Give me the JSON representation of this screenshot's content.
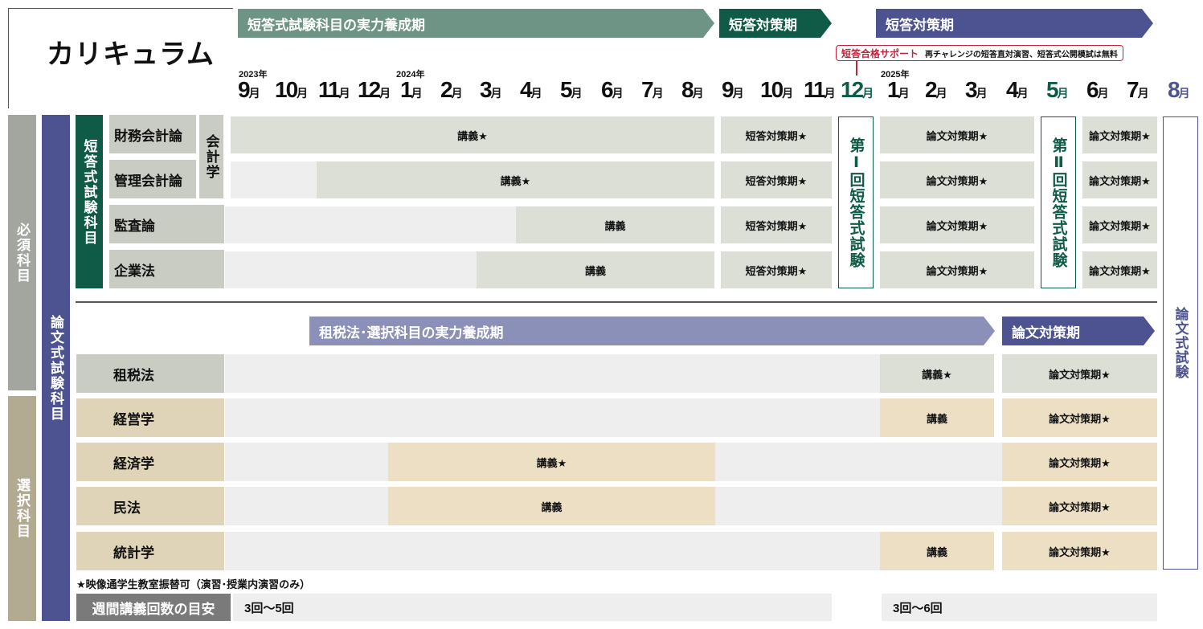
{
  "title": "カリキュラム",
  "phases": {
    "short_build": "短答式試験科目の実力養成期",
    "short_prep1": "短答対策期",
    "short_prep2": "短答対策期",
    "essay_build": "租税法･選択科目の実力養成期",
    "essay_prep": "論文対策期"
  },
  "support": {
    "title": "短答合格サポート",
    "note": "再チャレンジの短答直対演習、短答式公開模試は無料"
  },
  "years": [
    "2023年",
    "2024年",
    "2025年"
  ],
  "month_unit": "月",
  "months": [
    "9",
    "10",
    "11",
    "12",
    "1",
    "2",
    "3",
    "4",
    "5",
    "6",
    "7",
    "8",
    "9",
    "10",
    "11",
    "12",
    "1",
    "2",
    "3",
    "4",
    "5",
    "6",
    "7",
    "8"
  ],
  "side_labels": {
    "required": "必須科目",
    "elective": "選択科目",
    "essay_subjects": "論文式試験科目",
    "short_subjects": "短答式試験科目",
    "accounting": "会計学"
  },
  "exams": {
    "short_1": "第Ⅰ回短答式試験",
    "short_2": "第Ⅱ回短答式試験",
    "essay": "論文式試験"
  },
  "rows": [
    {
      "subject": "財務会計論",
      "main": "講義★",
      "prep": "短答対策期★",
      "essay1": "論文対策期★",
      "essay2": "論文対策期★"
    },
    {
      "subject": "管理会計論",
      "main": "講義★",
      "prep": "短答対策期★",
      "essay1": "論文対策期★",
      "essay2": "論文対策期★"
    },
    {
      "subject": "監査論",
      "main": "講義",
      "prep": "短答対策期★",
      "essay1": "論文対策期★",
      "essay2": "論文対策期★"
    },
    {
      "subject": "企業法",
      "main": "講義",
      "prep": "短答対策期★",
      "essay1": "論文対策期★",
      "essay2": "論文対策期★"
    }
  ],
  "elective_rows": [
    {
      "subject": "租税法",
      "lecture": "講義★",
      "essay": "論文対策期★"
    },
    {
      "subject": "経営学",
      "lecture": "講義",
      "essay": "論文対策期★"
    },
    {
      "subject": "経済学",
      "lecture": "講義★",
      "essay": "論文対策期★"
    },
    {
      "subject": "民法",
      "lecture": "講義",
      "essay": "論文対策期★"
    },
    {
      "subject": "統計学",
      "lecture": "講義",
      "essay": "論文対策期★"
    }
  ],
  "footnote": "★映像通学生教室振替可（演習･授業内演習のみ）",
  "weekly": {
    "label": "週間講義回数の目安",
    "first": "3回～5回",
    "second": "3回～6回"
  },
  "colors": {
    "green_phase": "#6e9486",
    "dark_green": "#0f5b47",
    "navy": "#4d5291",
    "slate": "#8b90b8",
    "red": "#c0243b",
    "beige": "#ecdfc4",
    "light_gray": "#dcdfd6"
  }
}
